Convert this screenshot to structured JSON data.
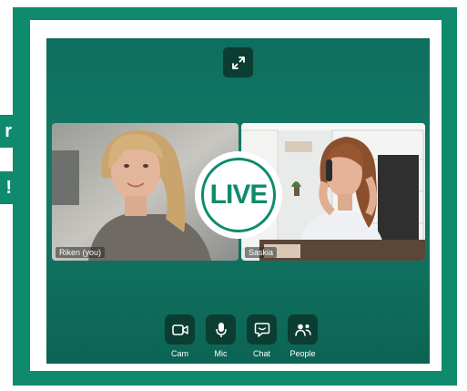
{
  "side_badges": {
    "top": "r",
    "bottom": "!"
  },
  "live_badge": {
    "text": "LIVE"
  },
  "participants": [
    {
      "name": "Riken (you)"
    },
    {
      "name": "Saskia"
    }
  ],
  "controls": [
    {
      "label": "Cam",
      "icon": "camera-icon"
    },
    {
      "label": "Mic",
      "icon": "microphone-icon"
    },
    {
      "label": "Chat",
      "icon": "chat-icon"
    },
    {
      "label": "People",
      "icon": "people-icon"
    }
  ],
  "colors": {
    "brand": "#0f8a6c",
    "button": "#0b3d33"
  }
}
